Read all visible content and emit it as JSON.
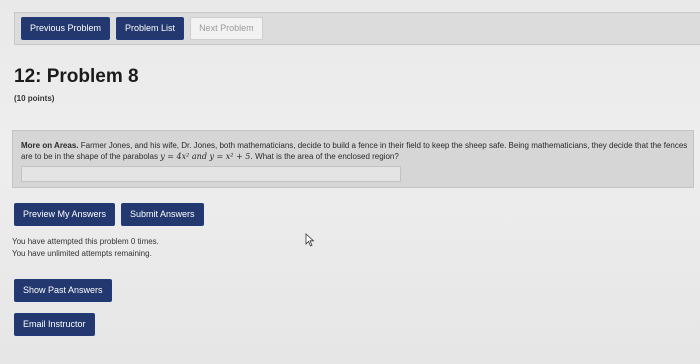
{
  "nav": {
    "previous_label": "Previous Problem",
    "list_label": "Problem List",
    "next_label": "Next Problem"
  },
  "problem": {
    "title": "12: Problem 8",
    "points": "(10 points)",
    "lead": "More on Areas.",
    "text_part1": "Farmer Jones, and his wife, Dr. Jones, both mathematicians, decide to build a fence in their field to keep the sheep safe. Being mathematicians, they decide that the fences are to be in the shape of the parabolas",
    "eq1": "y = 4x² and y = x² + 5.",
    "text_part2": "What is the area of the enclosed region?",
    "answer_value": ""
  },
  "actions": {
    "preview_label": "Preview My Answers",
    "submit_label": "Submit Answers"
  },
  "status": {
    "attempted": "You have attempted this problem 0 times.",
    "remaining": "You have unlimited attempts remaining."
  },
  "links": {
    "show_past_label": "Show Past Answers",
    "email_label": "Email Instructor"
  },
  "colors": {
    "button_bg": "#22386f",
    "page_bg": "#ececec",
    "problem_bg": "#d6d6d6"
  }
}
